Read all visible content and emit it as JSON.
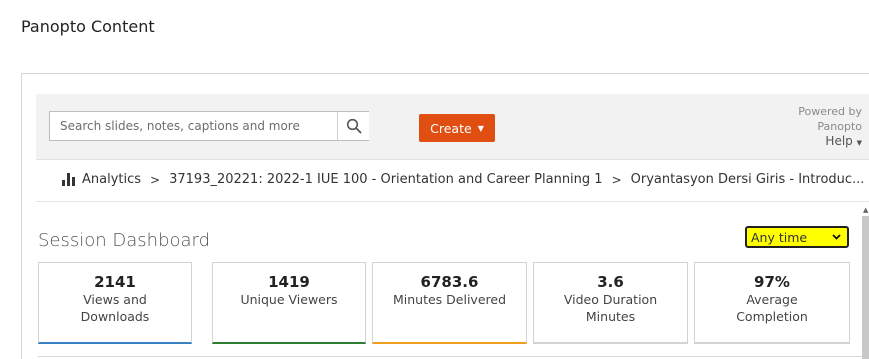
{
  "page": {
    "heading": "Panopto Content"
  },
  "toolbar": {
    "search_placeholder": "Search slides, notes, captions and more",
    "create_label": "Create",
    "powered_line1": "Powered by",
    "powered_line2": "Panopto",
    "help_label": "Help"
  },
  "breadcrumb": {
    "items": [
      "Analytics",
      "37193_20221: 2022-1 IUE 100 - Orientation and Career Planning 1",
      "Oryantasyon Dersi Giris - Introduc..."
    ]
  },
  "dashboard": {
    "title": "Session Dashboard",
    "time_filter": "Any time",
    "stats": [
      {
        "value": "2141",
        "label_line1": "Views and",
        "label_line2": "Downloads",
        "color": "#3a82c4"
      },
      {
        "value": "1419",
        "label_line1": "Unique Viewers",
        "label_line2": "",
        "color": "#2e7d32"
      },
      {
        "value": "6783.6",
        "label_line1": "Minutes Delivered",
        "label_line2": "",
        "color": "#f0a020"
      },
      {
        "value": "3.6",
        "label_line1": "Video Duration",
        "label_line2": "Minutes",
        "color": "#d3d3d3"
      },
      {
        "value": "97%",
        "label_line1": "Average",
        "label_line2": "Completion",
        "color": "#d3d3d3"
      }
    ]
  },
  "colors": {
    "create_button": "#e04e12",
    "highlight": "#ffff00"
  },
  "icons": {
    "search": "search-icon",
    "analytics": "bar-chart-icon",
    "separator": "chevron-right-icon"
  }
}
